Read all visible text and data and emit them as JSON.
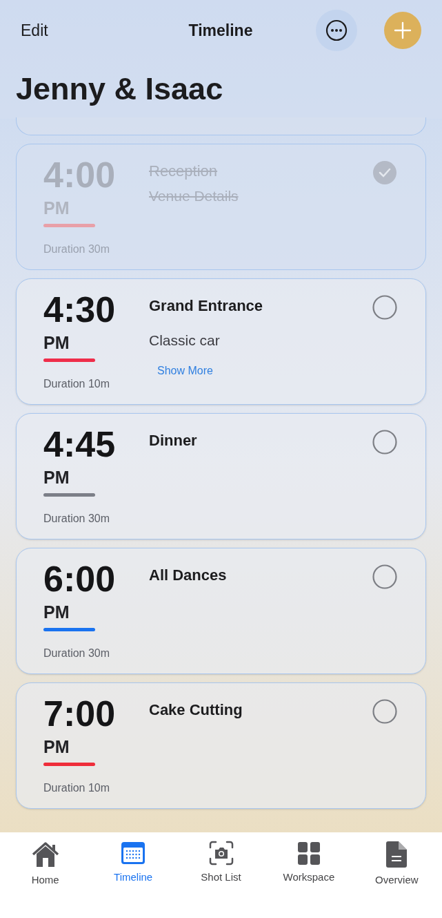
{
  "nav": {
    "edit": "Edit",
    "title": "Timeline"
  },
  "heading": "Jenny & Isaac",
  "events": [
    {
      "time": "4:00",
      "period": "PM",
      "color": "#e8a0a8",
      "duration": "Duration 30m",
      "title": "Reception",
      "subtitle": "Venue Details",
      "done": true
    },
    {
      "time": "4:30",
      "period": "PM",
      "color": "#ef2d4a",
      "duration": "Duration 10m",
      "title": "Grand Entrance",
      "subtitle": "Classic car",
      "more": "Show More",
      "done": false
    },
    {
      "time": "4:45",
      "period": "PM",
      "color": "#7c7f88",
      "duration": "Duration 30m",
      "title": "Dinner",
      "done": false
    },
    {
      "time": "6:00",
      "period": "PM",
      "color": "#1a73f0",
      "duration": "Duration 30m",
      "title": "All Dances",
      "done": false
    },
    {
      "time": "7:00",
      "period": "PM",
      "color": "#ef2d3a",
      "duration": "Duration 10m",
      "title": "Cake Cutting",
      "done": false
    }
  ],
  "tabs": [
    {
      "label": "Home",
      "kind": "home",
      "selected": false
    },
    {
      "label": "Timeline",
      "kind": "calendar",
      "selected": true
    },
    {
      "label": "Shot List",
      "kind": "camera",
      "selected": false
    },
    {
      "label": "Workspace",
      "kind": "grid",
      "selected": false
    },
    {
      "label": "Overview",
      "kind": "document",
      "selected": false
    }
  ]
}
